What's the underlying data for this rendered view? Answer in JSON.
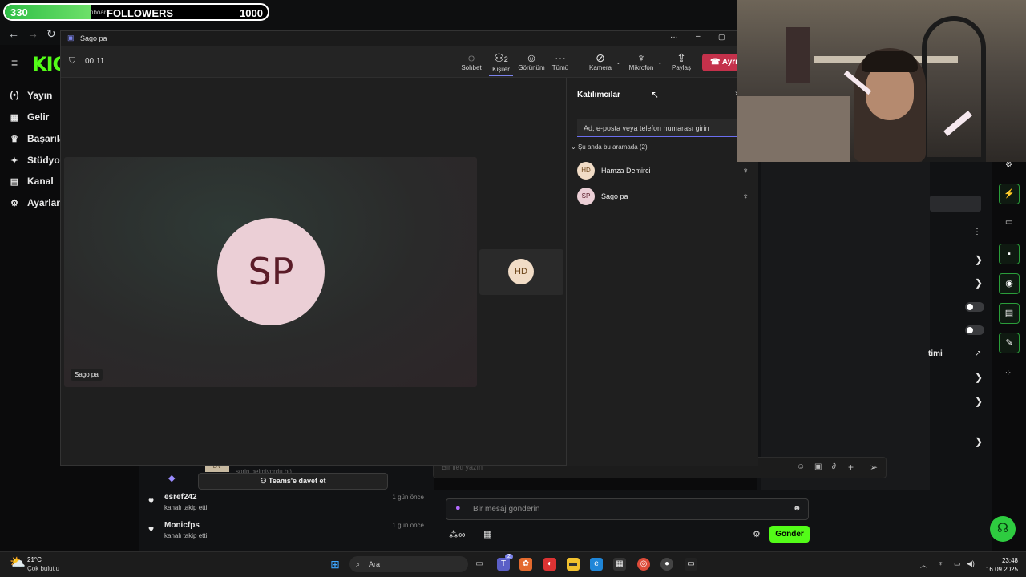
{
  "goal": {
    "current": "330",
    "label": "FOLLOWERS",
    "max": "1000",
    "progress": 0.33,
    "hidden_text": "nboard"
  },
  "kick": {
    "logo": "KIC",
    "menu": [
      {
        "icon": "broadcast-icon",
        "glyph": "(•)",
        "label": "Yayın"
      },
      {
        "icon": "revenue-icon",
        "glyph": "▦",
        "label": "Gelir"
      },
      {
        "icon": "trophy-icon",
        "glyph": "♛",
        "label": "Başarıla"
      },
      {
        "icon": "studio-icon",
        "glyph": "✦",
        "label": "Stüdyo"
      },
      {
        "icon": "channel-icon",
        "glyph": "▤",
        "label": "Kanal"
      },
      {
        "icon": "gear-icon",
        "glyph": "⚙",
        "label": "Ayarlar"
      }
    ],
    "partial_label": "timi",
    "follows": [
      {
        "name": "esref242",
        "sub": "kanalı takip etti",
        "time": "1 gün önce"
      },
      {
        "name": "Monicfps",
        "sub": "kanalı takip etti",
        "time": "1 gün önce"
      }
    ],
    "partial_row_text": "sorin gelmiyordu bö",
    "partial_avatar": "BV",
    "chat_placeholder": "Bir mesaj gönderin",
    "send_label": "Gönder"
  },
  "teams": {
    "window_title": "Sago pa",
    "timer": "00:11",
    "toolbar": {
      "chat": "Sohbet",
      "people": "Kişiler",
      "people_count": "2",
      "view": "Görünüm",
      "more": "Tümü",
      "camera": "Kamera",
      "mic": "Mikrofon",
      "share": "Paylaş",
      "leave": "Ayrıl"
    },
    "main_avatar": "SP",
    "main_name": "Sago pa",
    "tile_avatar": "HD",
    "panel": {
      "title": "Katılımcılar",
      "search_placeholder": "Ad, e-posta veya telefon numarası girin",
      "section": "Şu anda bu aramada (2)",
      "participants": [
        {
          "initials": "HD",
          "name": "Hamza Demirci",
          "bg": "#f1dcc6",
          "fg": "#6b4317"
        },
        {
          "initials": "SP",
          "name": "Sago pa",
          "bg": "#ebcfd6",
          "fg": "#5a1c28"
        }
      ]
    },
    "invite_label": "Teams'e davet et",
    "composer_placeholder": "Bir ileti yazın"
  },
  "taskbar": {
    "weather_temp": "21°C",
    "weather_desc": "Çok bulutlu",
    "search": "Ara",
    "time": "23:48",
    "date": "16.09.2025",
    "teams_badge": "2"
  },
  "colors": {
    "kick_green": "#53fc18",
    "teams_leave": "#c4314b",
    "teams_accent": "#6b6ef0"
  }
}
